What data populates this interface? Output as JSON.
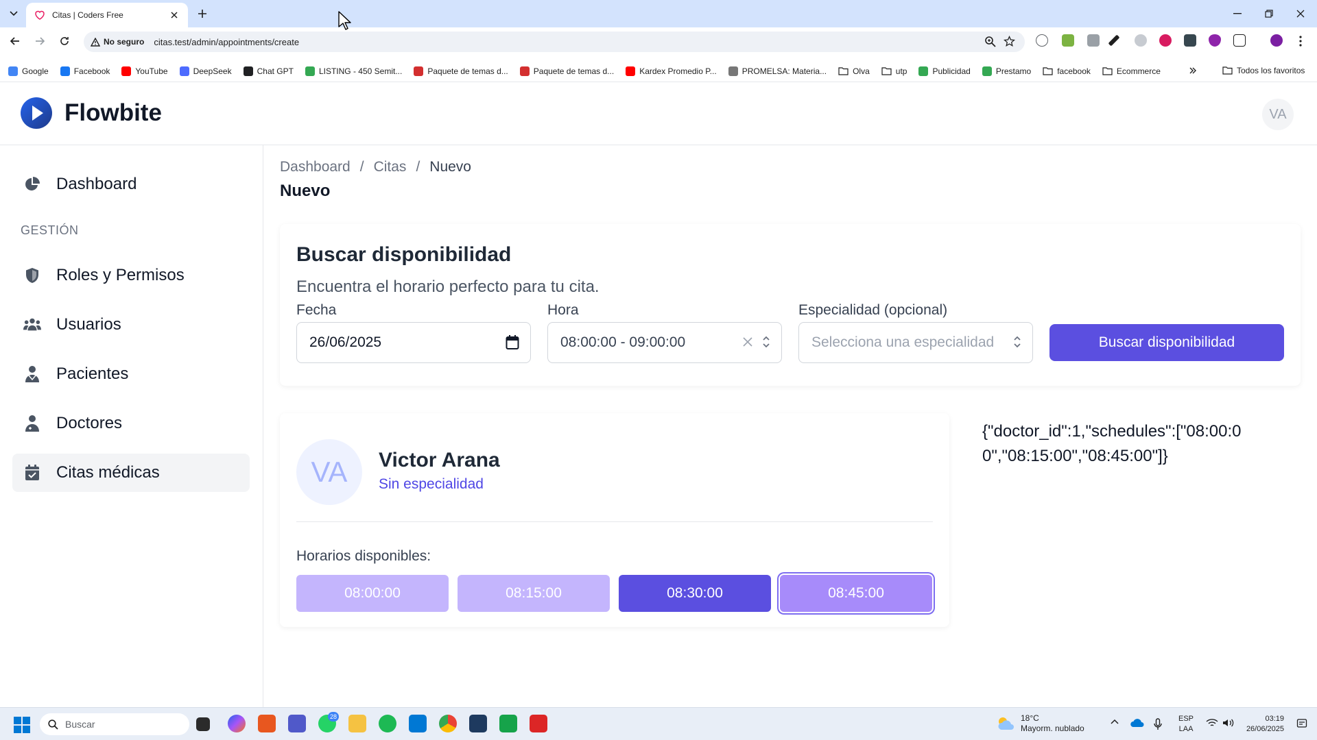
{
  "browser": {
    "tab_title": "Citas | Coders Free",
    "security_label": "No seguro",
    "url": "citas.test/admin/appointments/create",
    "bookmarks": [
      {
        "label": "Google",
        "color": "#4285f4"
      },
      {
        "label": "Facebook",
        "color": "#1877f2"
      },
      {
        "label": "YouTube",
        "color": "#ff0000"
      },
      {
        "label": "DeepSeek",
        "color": "#4d6bfe"
      },
      {
        "label": "Chat GPT",
        "color": "#202123"
      },
      {
        "label": "LISTING - 450 Semit...",
        "color": "#34a853"
      },
      {
        "label": "Paquete de temas d...",
        "color": "#d32f2f"
      },
      {
        "label": "Paquete de temas d...",
        "color": "#d32f2f"
      },
      {
        "label": "Kardex Promedio P...",
        "color": "#ff0000"
      },
      {
        "label": "PROMELSA: Materia...",
        "color": "#777777"
      },
      {
        "label": "Olva",
        "color": "folder"
      },
      {
        "label": "utp",
        "color": "folder"
      },
      {
        "label": "Publicidad",
        "color": "#34a853"
      },
      {
        "label": "Prestamo",
        "color": "#34a853"
      },
      {
        "label": "facebook",
        "color": "folder"
      },
      {
        "label": "Ecommerce",
        "color": "folder"
      }
    ],
    "all_bookmarks_label": "Todos los favoritos"
  },
  "app": {
    "brand": "Flowbite",
    "user_initials": "VA",
    "colors": {
      "primary": "#5b4fe0",
      "slot_light": "#c4b5fd",
      "accent_text": "#4f46e5"
    }
  },
  "sidebar": {
    "dashboard": "Dashboard",
    "section_heading": "GESTIÓN",
    "roles": "Roles y Permisos",
    "users": "Usuarios",
    "patients": "Pacientes",
    "doctors": "Doctores",
    "appointments": "Citas médicas"
  },
  "breadcrumb": {
    "root": "Dashboard",
    "section": "Citas",
    "current": "Nuevo"
  },
  "page_title": "Nuevo",
  "search": {
    "title": "Buscar disponibilidad",
    "subtitle": "Encuentra el horario perfecto para tu cita.",
    "date_label": "Fecha",
    "date_value": "26/06/2025",
    "hour_label": "Hora",
    "hour_value": "08:00:00 - 09:00:00",
    "specialty_label": "Especialidad (opcional)",
    "specialty_placeholder": "Selecciona una especialidad",
    "button": "Buscar disponibilidad"
  },
  "doctor": {
    "initials": "VA",
    "name": "Victor Arana",
    "specialty": "Sin especialidad",
    "slots_label": "Horarios disponibles:",
    "slots": [
      {
        "time": "08:00:00",
        "state": "unavailable"
      },
      {
        "time": "08:15:00",
        "state": "unavailable"
      },
      {
        "time": "08:30:00",
        "state": "available"
      },
      {
        "time": "08:45:00",
        "state": "selected"
      }
    ]
  },
  "debug_json": "{\"doctor_id\":1,\"schedules\":[\"08:00:00\",\"08:15:00\",\"08:45:00\"]}",
  "taskbar": {
    "search_placeholder": "Buscar",
    "whatsapp_badge": "28",
    "weather_temp": "18°C",
    "weather_desc": "Mayorm. nublado",
    "lang_top": "ESP",
    "lang_bottom": "LAA",
    "time": "03:19",
    "date": "26/06/2025"
  }
}
